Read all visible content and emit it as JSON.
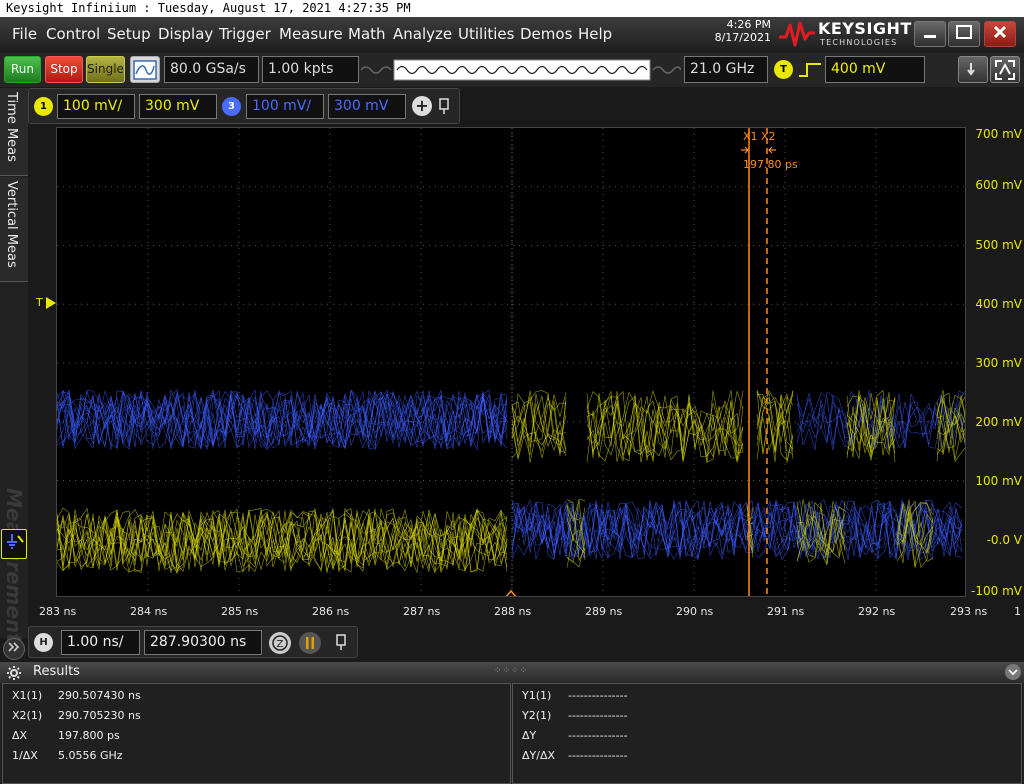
{
  "window": {
    "title": "Keysight Infiniium : Tuesday, August 17, 2021 4:27:35 PM"
  },
  "menu": [
    "File",
    "Control",
    "Setup",
    "Display",
    "Trigger",
    "Measure",
    "Math",
    "Analyze",
    "Utilities",
    "Demos",
    "Help"
  ],
  "header": {
    "time": "4:26 PM",
    "date": "8/17/2021",
    "brand": "KEYSIGHT",
    "brand_sub": "TECHNOLOGIES"
  },
  "toolbar": {
    "run": "Run",
    "stop": "Stop",
    "single": "Single",
    "sample_rate": "80.0 GSa/s",
    "points": "1.00 kpts",
    "bandwidth": "21.0 GHz",
    "trigger_badge": "T",
    "trigger_level": "400 mV"
  },
  "channels": {
    "ch1": {
      "badge": "1",
      "scale": "100 mV/",
      "offset": "300 mV",
      "color": "#e8e800"
    },
    "ch3": {
      "badge": "3",
      "scale": "100 mV/",
      "offset": "300 mV",
      "color": "#4a6bff"
    }
  },
  "side_tabs": {
    "time": "Time Meas",
    "vertical": "Vertical Meas",
    "watermark": "Measurements"
  },
  "screen": {
    "trigger_marker": "T",
    "cursor_x1": "X1",
    "cursor_x2": "X2",
    "cursor_delta": "197.80 ps",
    "y_labels": [
      "700 mV",
      "600 mV",
      "500 mV",
      "400 mV",
      "300 mV",
      "200 mV",
      "100 mV",
      "-0.0 V",
      "-100 mV"
    ],
    "x_labels": [
      "283 ns",
      "284 ns",
      "285 ns",
      "286 ns",
      "287 ns",
      "288 ns",
      "289 ns",
      "290 ns",
      "291 ns",
      "292 ns",
      "293 ns"
    ],
    "x_labels_extra": "1"
  },
  "timebase": {
    "badge": "H",
    "scale": "1.00 ns/",
    "position": "287.90300 ns"
  },
  "results": {
    "title": "Results",
    "left": [
      {
        "label": "X1(1)",
        "value": "290.507430 ns"
      },
      {
        "label": "X2(1)",
        "value": "290.705230 ns"
      },
      {
        "label": "ΔX",
        "value": "197.800 ps"
      },
      {
        "label": "1/ΔX",
        "value": "5.0556 GHz"
      }
    ],
    "right": [
      {
        "label": "Y1(1)",
        "value": "---------------"
      },
      {
        "label": "Y2(1)",
        "value": "---------------"
      },
      {
        "label": "ΔY",
        "value": "---------------"
      },
      {
        "label": "ΔY/ΔX",
        "value": "---------------"
      }
    ]
  }
}
